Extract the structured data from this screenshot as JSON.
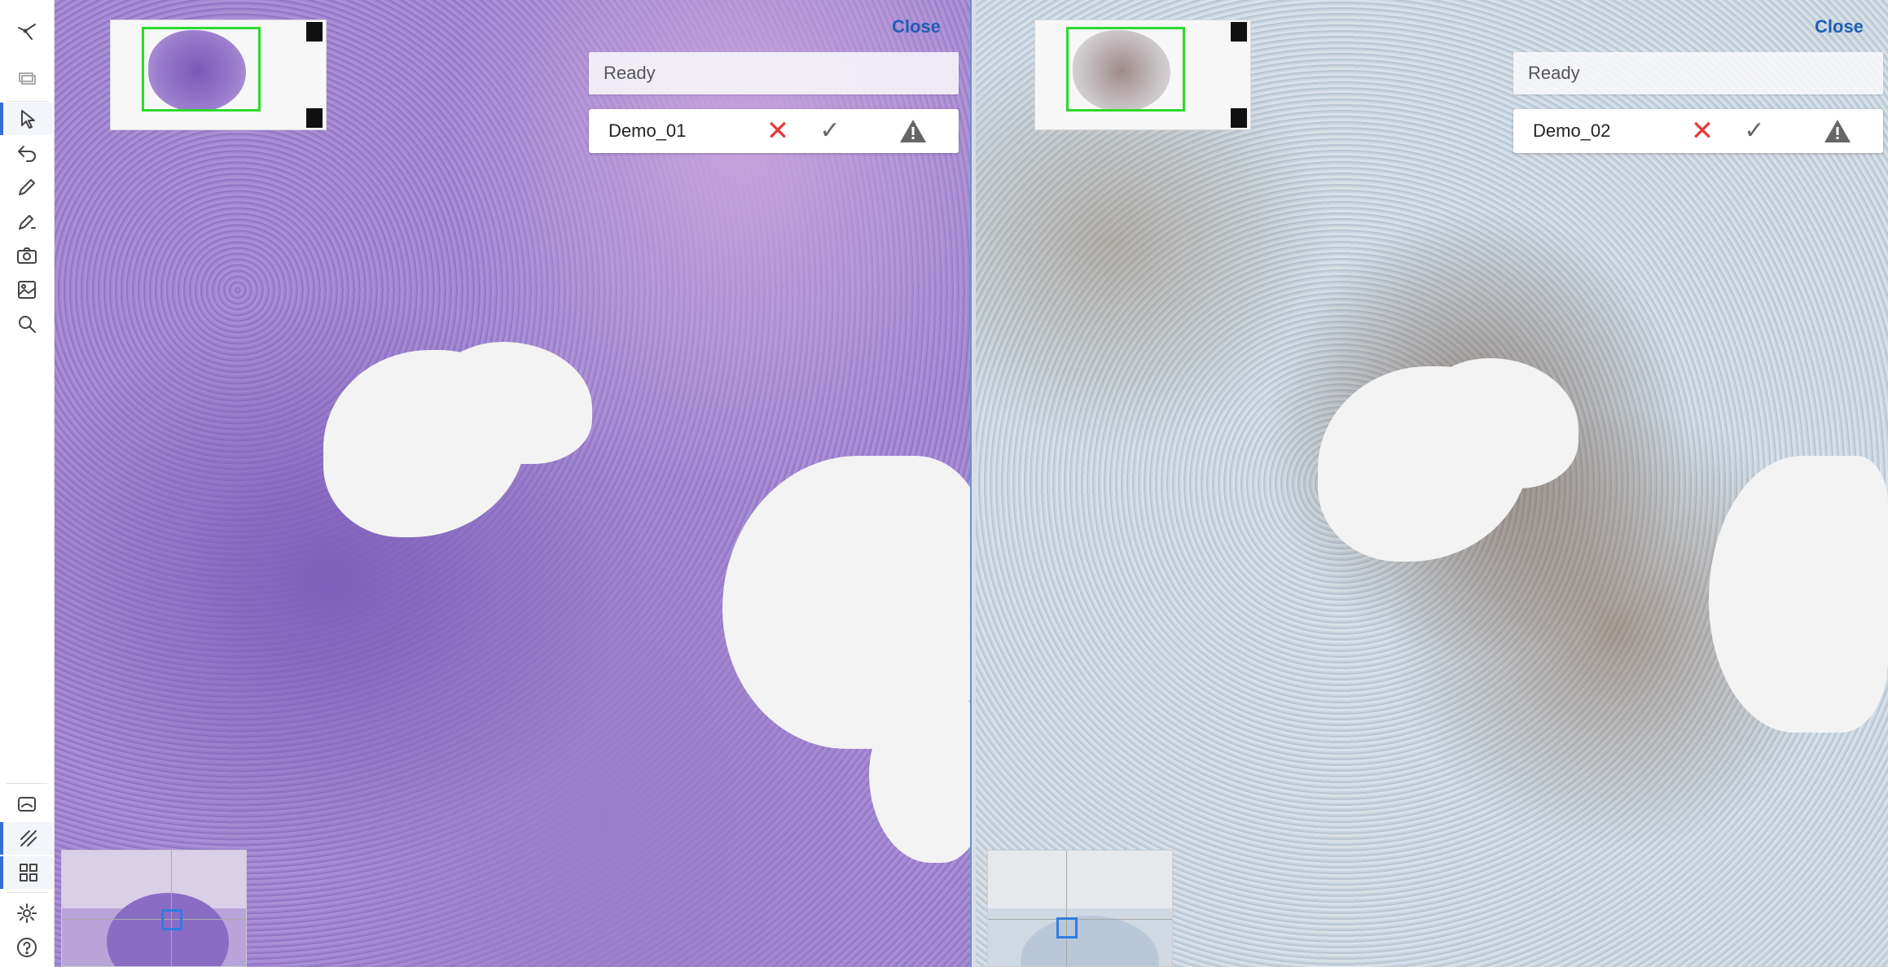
{
  "toolbar": {
    "top_tools": [
      "route-icon",
      "layers-icon",
      "pointer-icon",
      "undo-icon",
      "pencil-icon",
      "ai-pen-icon",
      "camera-icon",
      "image-icon",
      "search-icon"
    ],
    "bottom_tools": [
      "overview-icon",
      "draw-toggle-icon",
      "grid-icon",
      "gear-icon",
      "help-icon"
    ],
    "active_tools": [
      "pointer-icon",
      "draw-toggle-icon",
      "grid-icon"
    ]
  },
  "viewers": {
    "left": {
      "stain": "H&E",
      "status": "Ready",
      "slide_name": "Demo_01",
      "close_label": "Close"
    },
    "right": {
      "stain": "IHC",
      "status": "Ready",
      "slide_name": "Demo_02",
      "close_label": "Close"
    }
  },
  "icons": {
    "reject": "✕",
    "accept": "✓"
  },
  "colors": {
    "accent": "#3b6bd6",
    "overview_frame": "#2dd82d",
    "navigator_box": "#2f7de0",
    "reject": "#e23b3b",
    "close_link": "#1e5fb4"
  }
}
